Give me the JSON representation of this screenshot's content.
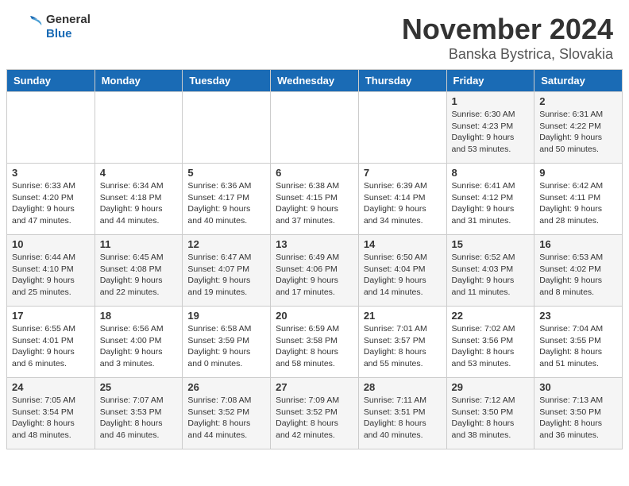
{
  "header": {
    "logo": {
      "general": "General",
      "blue": "Blue"
    },
    "title": "November 2024",
    "location": "Banska Bystrica, Slovakia"
  },
  "calendar": {
    "weekdays": [
      "Sunday",
      "Monday",
      "Tuesday",
      "Wednesday",
      "Thursday",
      "Friday",
      "Saturday"
    ],
    "weeks": [
      [
        {
          "day": "",
          "info": ""
        },
        {
          "day": "",
          "info": ""
        },
        {
          "day": "",
          "info": ""
        },
        {
          "day": "",
          "info": ""
        },
        {
          "day": "",
          "info": ""
        },
        {
          "day": "1",
          "info": "Sunrise: 6:30 AM\nSunset: 4:23 PM\nDaylight: 9 hours and 53 minutes."
        },
        {
          "day": "2",
          "info": "Sunrise: 6:31 AM\nSunset: 4:22 PM\nDaylight: 9 hours and 50 minutes."
        }
      ],
      [
        {
          "day": "3",
          "info": "Sunrise: 6:33 AM\nSunset: 4:20 PM\nDaylight: 9 hours and 47 minutes."
        },
        {
          "day": "4",
          "info": "Sunrise: 6:34 AM\nSunset: 4:18 PM\nDaylight: 9 hours and 44 minutes."
        },
        {
          "day": "5",
          "info": "Sunrise: 6:36 AM\nSunset: 4:17 PM\nDaylight: 9 hours and 40 minutes."
        },
        {
          "day": "6",
          "info": "Sunrise: 6:38 AM\nSunset: 4:15 PM\nDaylight: 9 hours and 37 minutes."
        },
        {
          "day": "7",
          "info": "Sunrise: 6:39 AM\nSunset: 4:14 PM\nDaylight: 9 hours and 34 minutes."
        },
        {
          "day": "8",
          "info": "Sunrise: 6:41 AM\nSunset: 4:12 PM\nDaylight: 9 hours and 31 minutes."
        },
        {
          "day": "9",
          "info": "Sunrise: 6:42 AM\nSunset: 4:11 PM\nDaylight: 9 hours and 28 minutes."
        }
      ],
      [
        {
          "day": "10",
          "info": "Sunrise: 6:44 AM\nSunset: 4:10 PM\nDaylight: 9 hours and 25 minutes."
        },
        {
          "day": "11",
          "info": "Sunrise: 6:45 AM\nSunset: 4:08 PM\nDaylight: 9 hours and 22 minutes."
        },
        {
          "day": "12",
          "info": "Sunrise: 6:47 AM\nSunset: 4:07 PM\nDaylight: 9 hours and 19 minutes."
        },
        {
          "day": "13",
          "info": "Sunrise: 6:49 AM\nSunset: 4:06 PM\nDaylight: 9 hours and 17 minutes."
        },
        {
          "day": "14",
          "info": "Sunrise: 6:50 AM\nSunset: 4:04 PM\nDaylight: 9 hours and 14 minutes."
        },
        {
          "day": "15",
          "info": "Sunrise: 6:52 AM\nSunset: 4:03 PM\nDaylight: 9 hours and 11 minutes."
        },
        {
          "day": "16",
          "info": "Sunrise: 6:53 AM\nSunset: 4:02 PM\nDaylight: 9 hours and 8 minutes."
        }
      ],
      [
        {
          "day": "17",
          "info": "Sunrise: 6:55 AM\nSunset: 4:01 PM\nDaylight: 9 hours and 6 minutes."
        },
        {
          "day": "18",
          "info": "Sunrise: 6:56 AM\nSunset: 4:00 PM\nDaylight: 9 hours and 3 minutes."
        },
        {
          "day": "19",
          "info": "Sunrise: 6:58 AM\nSunset: 3:59 PM\nDaylight: 9 hours and 0 minutes."
        },
        {
          "day": "20",
          "info": "Sunrise: 6:59 AM\nSunset: 3:58 PM\nDaylight: 8 hours and 58 minutes."
        },
        {
          "day": "21",
          "info": "Sunrise: 7:01 AM\nSunset: 3:57 PM\nDaylight: 8 hours and 55 minutes."
        },
        {
          "day": "22",
          "info": "Sunrise: 7:02 AM\nSunset: 3:56 PM\nDaylight: 8 hours and 53 minutes."
        },
        {
          "day": "23",
          "info": "Sunrise: 7:04 AM\nSunset: 3:55 PM\nDaylight: 8 hours and 51 minutes."
        }
      ],
      [
        {
          "day": "24",
          "info": "Sunrise: 7:05 AM\nSunset: 3:54 PM\nDaylight: 8 hours and 48 minutes."
        },
        {
          "day": "25",
          "info": "Sunrise: 7:07 AM\nSunset: 3:53 PM\nDaylight: 8 hours and 46 minutes."
        },
        {
          "day": "26",
          "info": "Sunrise: 7:08 AM\nSunset: 3:52 PM\nDaylight: 8 hours and 44 minutes."
        },
        {
          "day": "27",
          "info": "Sunrise: 7:09 AM\nSunset: 3:52 PM\nDaylight: 8 hours and 42 minutes."
        },
        {
          "day": "28",
          "info": "Sunrise: 7:11 AM\nSunset: 3:51 PM\nDaylight: 8 hours and 40 minutes."
        },
        {
          "day": "29",
          "info": "Sunrise: 7:12 AM\nSunset: 3:50 PM\nDaylight: 8 hours and 38 minutes."
        },
        {
          "day": "30",
          "info": "Sunrise: 7:13 AM\nSunset: 3:50 PM\nDaylight: 8 hours and 36 minutes."
        }
      ]
    ]
  }
}
